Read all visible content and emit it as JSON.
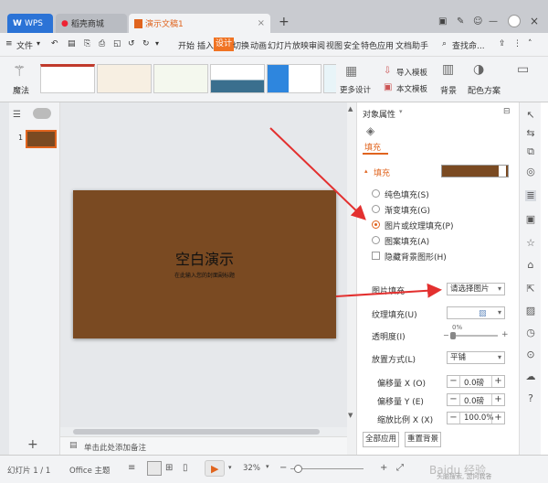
{
  "tabs": {
    "wps": "WPS",
    "store": "稻壳商城",
    "doc": "演示文稿1"
  },
  "menu": {
    "file": "文件",
    "items": [
      "开始",
      "插入",
      "设计",
      "切换",
      "动画",
      "幻灯片放映",
      "审阅",
      "视图",
      "安全",
      "特色应用",
      "文档助手"
    ],
    "search": "查找命..."
  },
  "ribbon": {
    "magic": "魔法",
    "more_design": "更多设计",
    "import_template": "导入模板",
    "this_template": "本文模板",
    "background": "背景",
    "color_scheme": "配色方案"
  },
  "slides_panel": {
    "slide_number": "1"
  },
  "slide": {
    "title": "空白演示",
    "subtitle": "在此输入您的封面副标题"
  },
  "notes_placeholder": "单击此处添加备注",
  "panel": {
    "title": "对象属性",
    "tab_fill": "填充",
    "section_fill": "填充",
    "options": [
      "纯色填充(S)",
      "渐变填充(G)",
      "图片或纹理填充(P)",
      "图案填充(A)"
    ],
    "hide_bg": "隐藏背景图形(H)",
    "picture_fill_label": "图片填充",
    "picture_fill_value": "请选择图片",
    "texture_fill_label": "纹理填充(U)",
    "transparency_label": "透明度(I)",
    "transparency_value": "0%",
    "placement_label": "放置方式(L)",
    "placement_value": "平铺",
    "offset_x_label": "偏移量 X (O)",
    "offset_x_value": "0.0磅",
    "offset_y_label": "偏移量 Y (E)",
    "offset_y_value": "0.0磅",
    "scale_x_label": "缩放比例 X (X)",
    "scale_x_value": "100.0%",
    "apply_all": "全部应用",
    "reset": "重置背景"
  },
  "status": {
    "slide_count": "幻灯片 1 / 1",
    "theme": "Office 主题",
    "zoom": "32%",
    "watermark": "Baidu 经验",
    "helper": "头脑搜索, 您问我答"
  },
  "colors": {
    "accent": "#e0641e",
    "slide_bg": "#7a4a22",
    "arrow": "#e3302f"
  }
}
